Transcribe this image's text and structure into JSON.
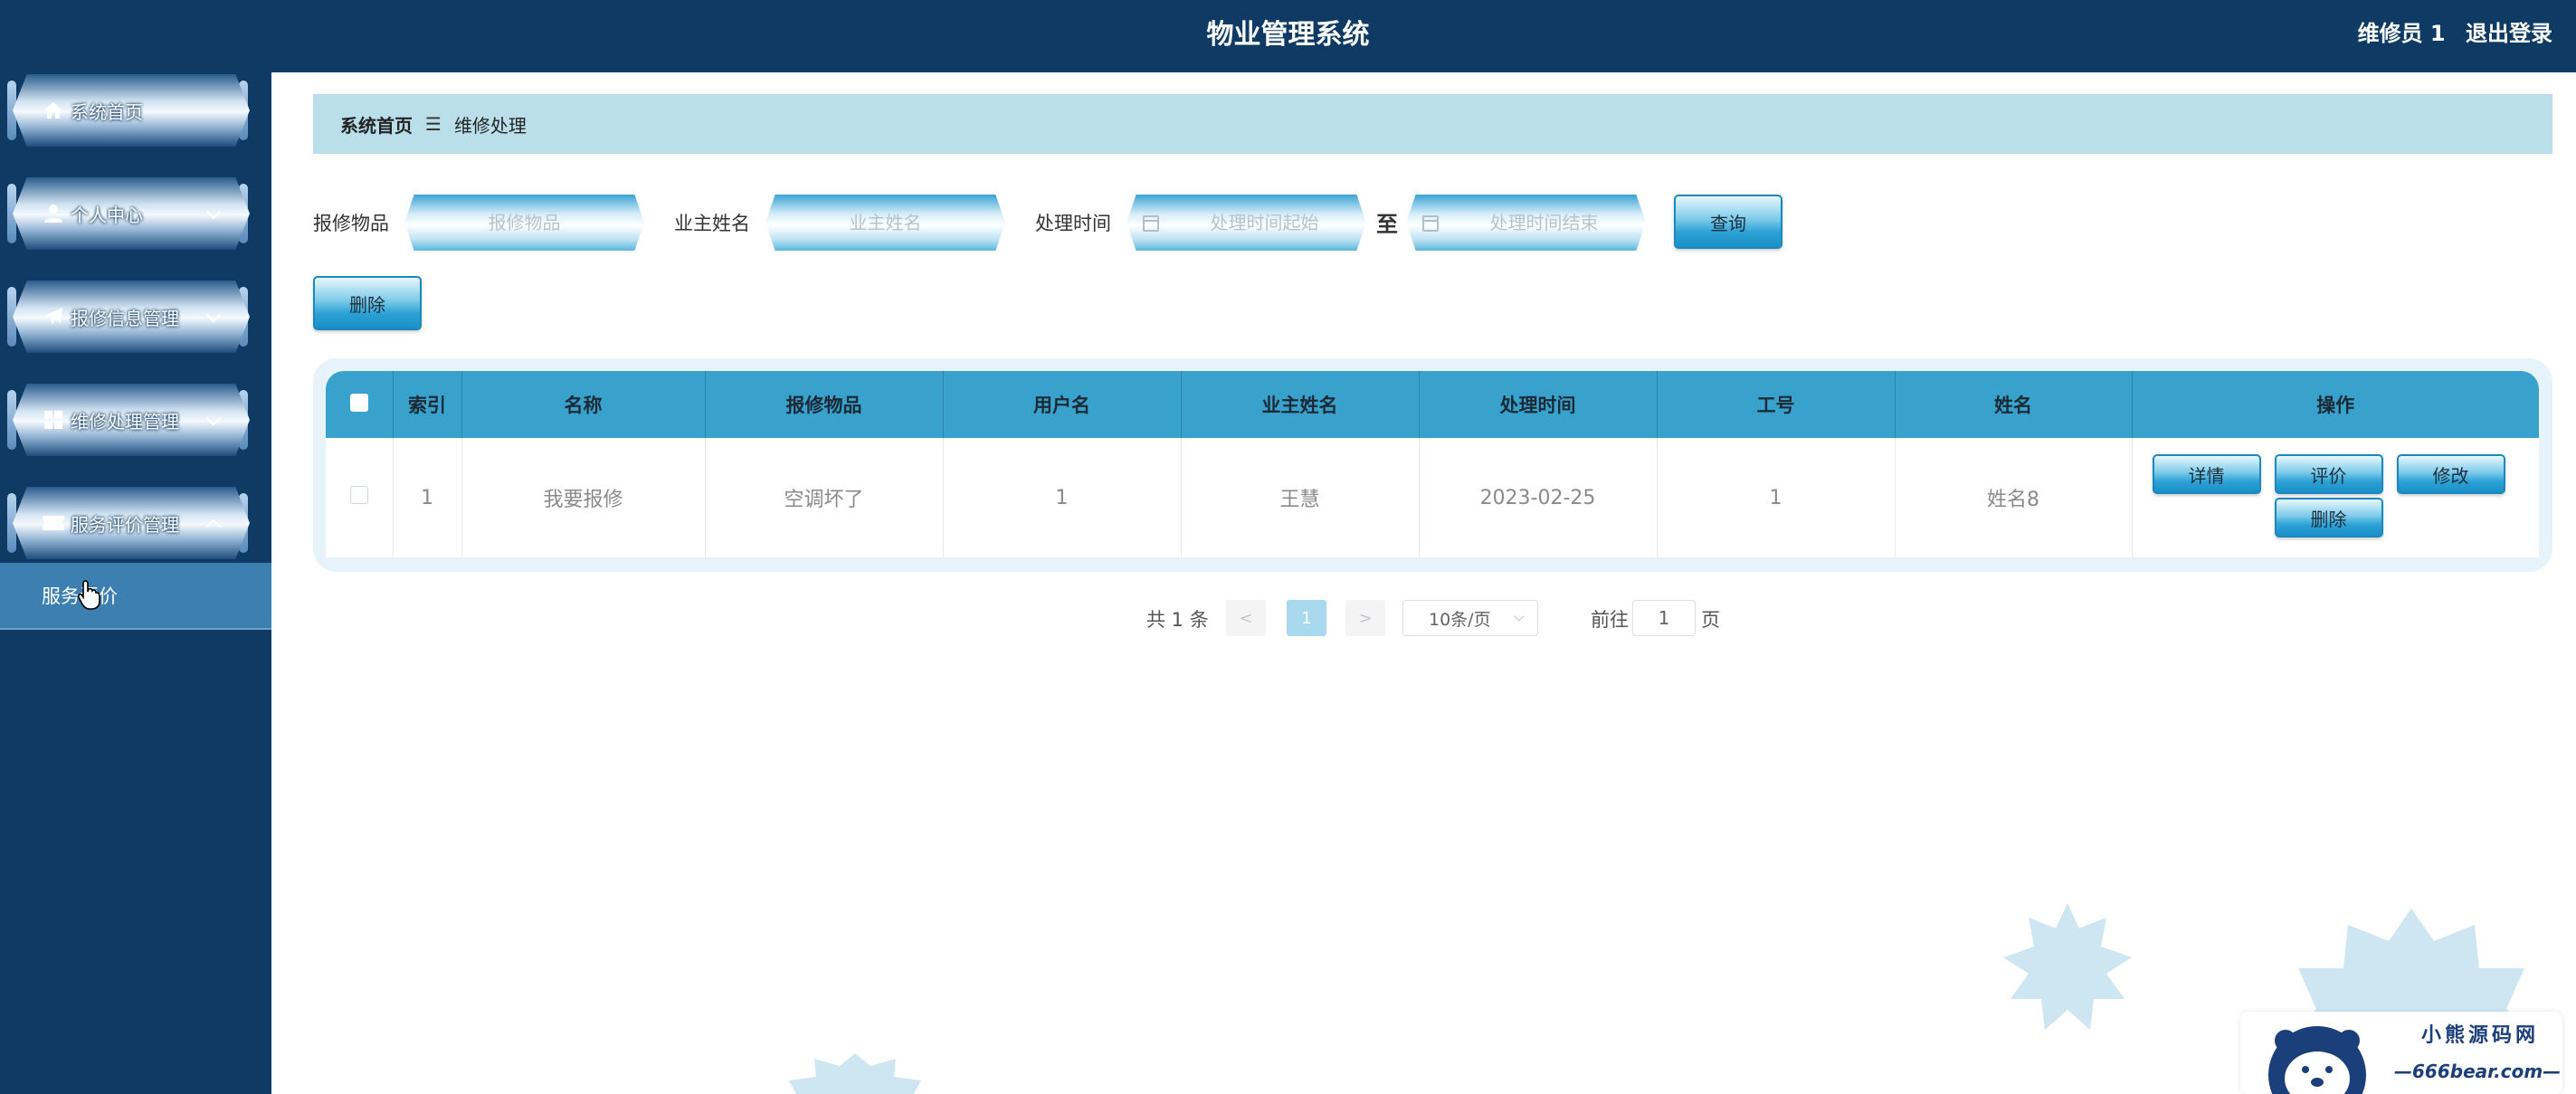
{
  "header": {
    "app_title": "物业管理系统",
    "user_name": "维修员 1",
    "logout_label": "退出登录"
  },
  "sidebar": {
    "items": [
      {
        "label": "系统首页",
        "icon": "home-icon",
        "has_chevron": false
      },
      {
        "label": "个人中心",
        "icon": "user-icon",
        "has_chevron": true,
        "expanded": false
      },
      {
        "label": "报修信息管理",
        "icon": "paper-plane-icon",
        "has_chevron": true,
        "expanded": false
      },
      {
        "label": "维修处理管理",
        "icon": "grid-icon",
        "has_chevron": true,
        "expanded": false
      },
      {
        "label": "服务评价管理",
        "icon": "ticket-icon",
        "has_chevron": true,
        "expanded": true
      }
    ],
    "submenu": {
      "label": "服务评价"
    }
  },
  "breadcrumb": {
    "home": "系统首页",
    "separator": "☰",
    "current": "维修处理"
  },
  "search": {
    "item_label": "报修物品",
    "item_placeholder": "报修物品",
    "owner_label": "业主姓名",
    "owner_placeholder": "业主姓名",
    "time_label": "处理时间",
    "time_start_placeholder": "处理时间起始",
    "range_separator": "至",
    "time_end_placeholder": "处理时间结束",
    "query_button": "查询"
  },
  "toolbar": {
    "delete_button": "删除"
  },
  "table": {
    "columns": [
      "索引",
      "名称",
      "报修物品",
      "用户名",
      "业主姓名",
      "处理时间",
      "工号",
      "姓名",
      "操作"
    ],
    "rows": [
      {
        "index": "1",
        "name": "我要报修",
        "item": "空调坏了",
        "username": "1",
        "owner_name": "王慧",
        "process_time": "2023-02-25",
        "work_no": "1",
        "staff_name": "姓名8",
        "actions": [
          "详情",
          "评价",
          "修改",
          "删除"
        ]
      }
    ]
  },
  "pagination": {
    "total_text": "共 1 条",
    "prev": "<",
    "current_page": "1",
    "next": ">",
    "page_size": "10条/页",
    "goto_prefix": "前往",
    "goto_value": "1",
    "goto_suffix": "页"
  },
  "watermark": {
    "line1": "小熊源码网",
    "line2": "—666bear.com—"
  },
  "colors": {
    "header_bg": "#0e3a63",
    "breadcrumb_bg": "#badfea",
    "table_header_bg": "#39a2cc",
    "submenu_active_bg": "#3d7fb0"
  }
}
